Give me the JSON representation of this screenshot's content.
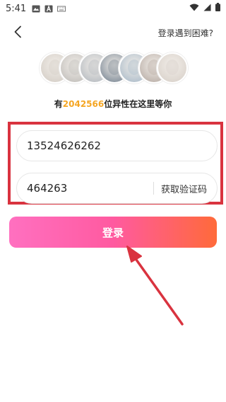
{
  "status_bar": {
    "time": "5:41",
    "icons": [
      "image-icon",
      "font-icon",
      "keyboard-icon"
    ],
    "right_icons": [
      "wifi-icon",
      "cellular-icon",
      "battery-icon"
    ]
  },
  "header": {
    "back_icon": "chevron-left-icon",
    "help_label": "登录遇到困难?"
  },
  "avatars": {
    "count": 7,
    "colors": [
      "#d9d3cc",
      "#c9c6c2",
      "#bfc3c7",
      "#8f99a3",
      "#b7c4cf",
      "#c2b8b1",
      "#ddd6cf"
    ]
  },
  "tagline": {
    "prefix": "有",
    "count": "2042566",
    "suffix": "位异性在这里等你",
    "highlight_color": "#f5a623"
  },
  "form": {
    "phone_value": "13524626262",
    "code_value": "464263",
    "get_code_label": "获取验证码",
    "highlight_box_color": "#d9333f"
  },
  "login": {
    "label": "登录"
  },
  "annotation": {
    "arrow_color": "#d9333f"
  }
}
